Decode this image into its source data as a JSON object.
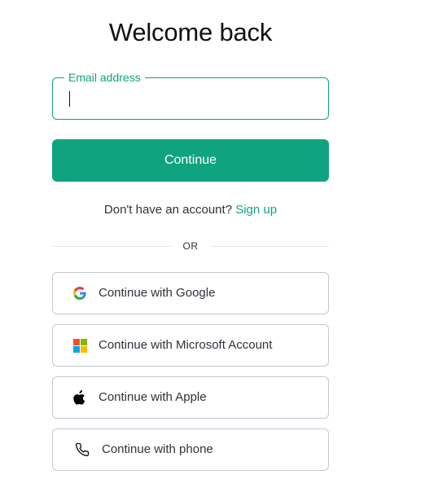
{
  "page": {
    "title": "Welcome back"
  },
  "email": {
    "label": "Email address",
    "value": "",
    "placeholder": ""
  },
  "continue_button": {
    "label": "Continue"
  },
  "signup": {
    "prompt": "Don't have an account?",
    "link_label": "Sign up"
  },
  "divider": {
    "text": "OR"
  },
  "social": {
    "google": {
      "label": "Continue with Google",
      "icon": "google-icon"
    },
    "microsoft": {
      "label": "Continue with Microsoft Account",
      "icon": "microsoft-icon"
    },
    "apple": {
      "label": "Continue with Apple",
      "icon": "apple-icon"
    },
    "phone": {
      "label": "Continue with phone",
      "icon": "phone-icon"
    }
  },
  "colors": {
    "accent": "#10a37f",
    "border": "#c2c8d0",
    "text": "#2d333a",
    "microsoft_red": "#f25022",
    "microsoft_green": "#7fba00",
    "microsoft_blue": "#00a4ef",
    "microsoft_yellow": "#ffb900"
  }
}
